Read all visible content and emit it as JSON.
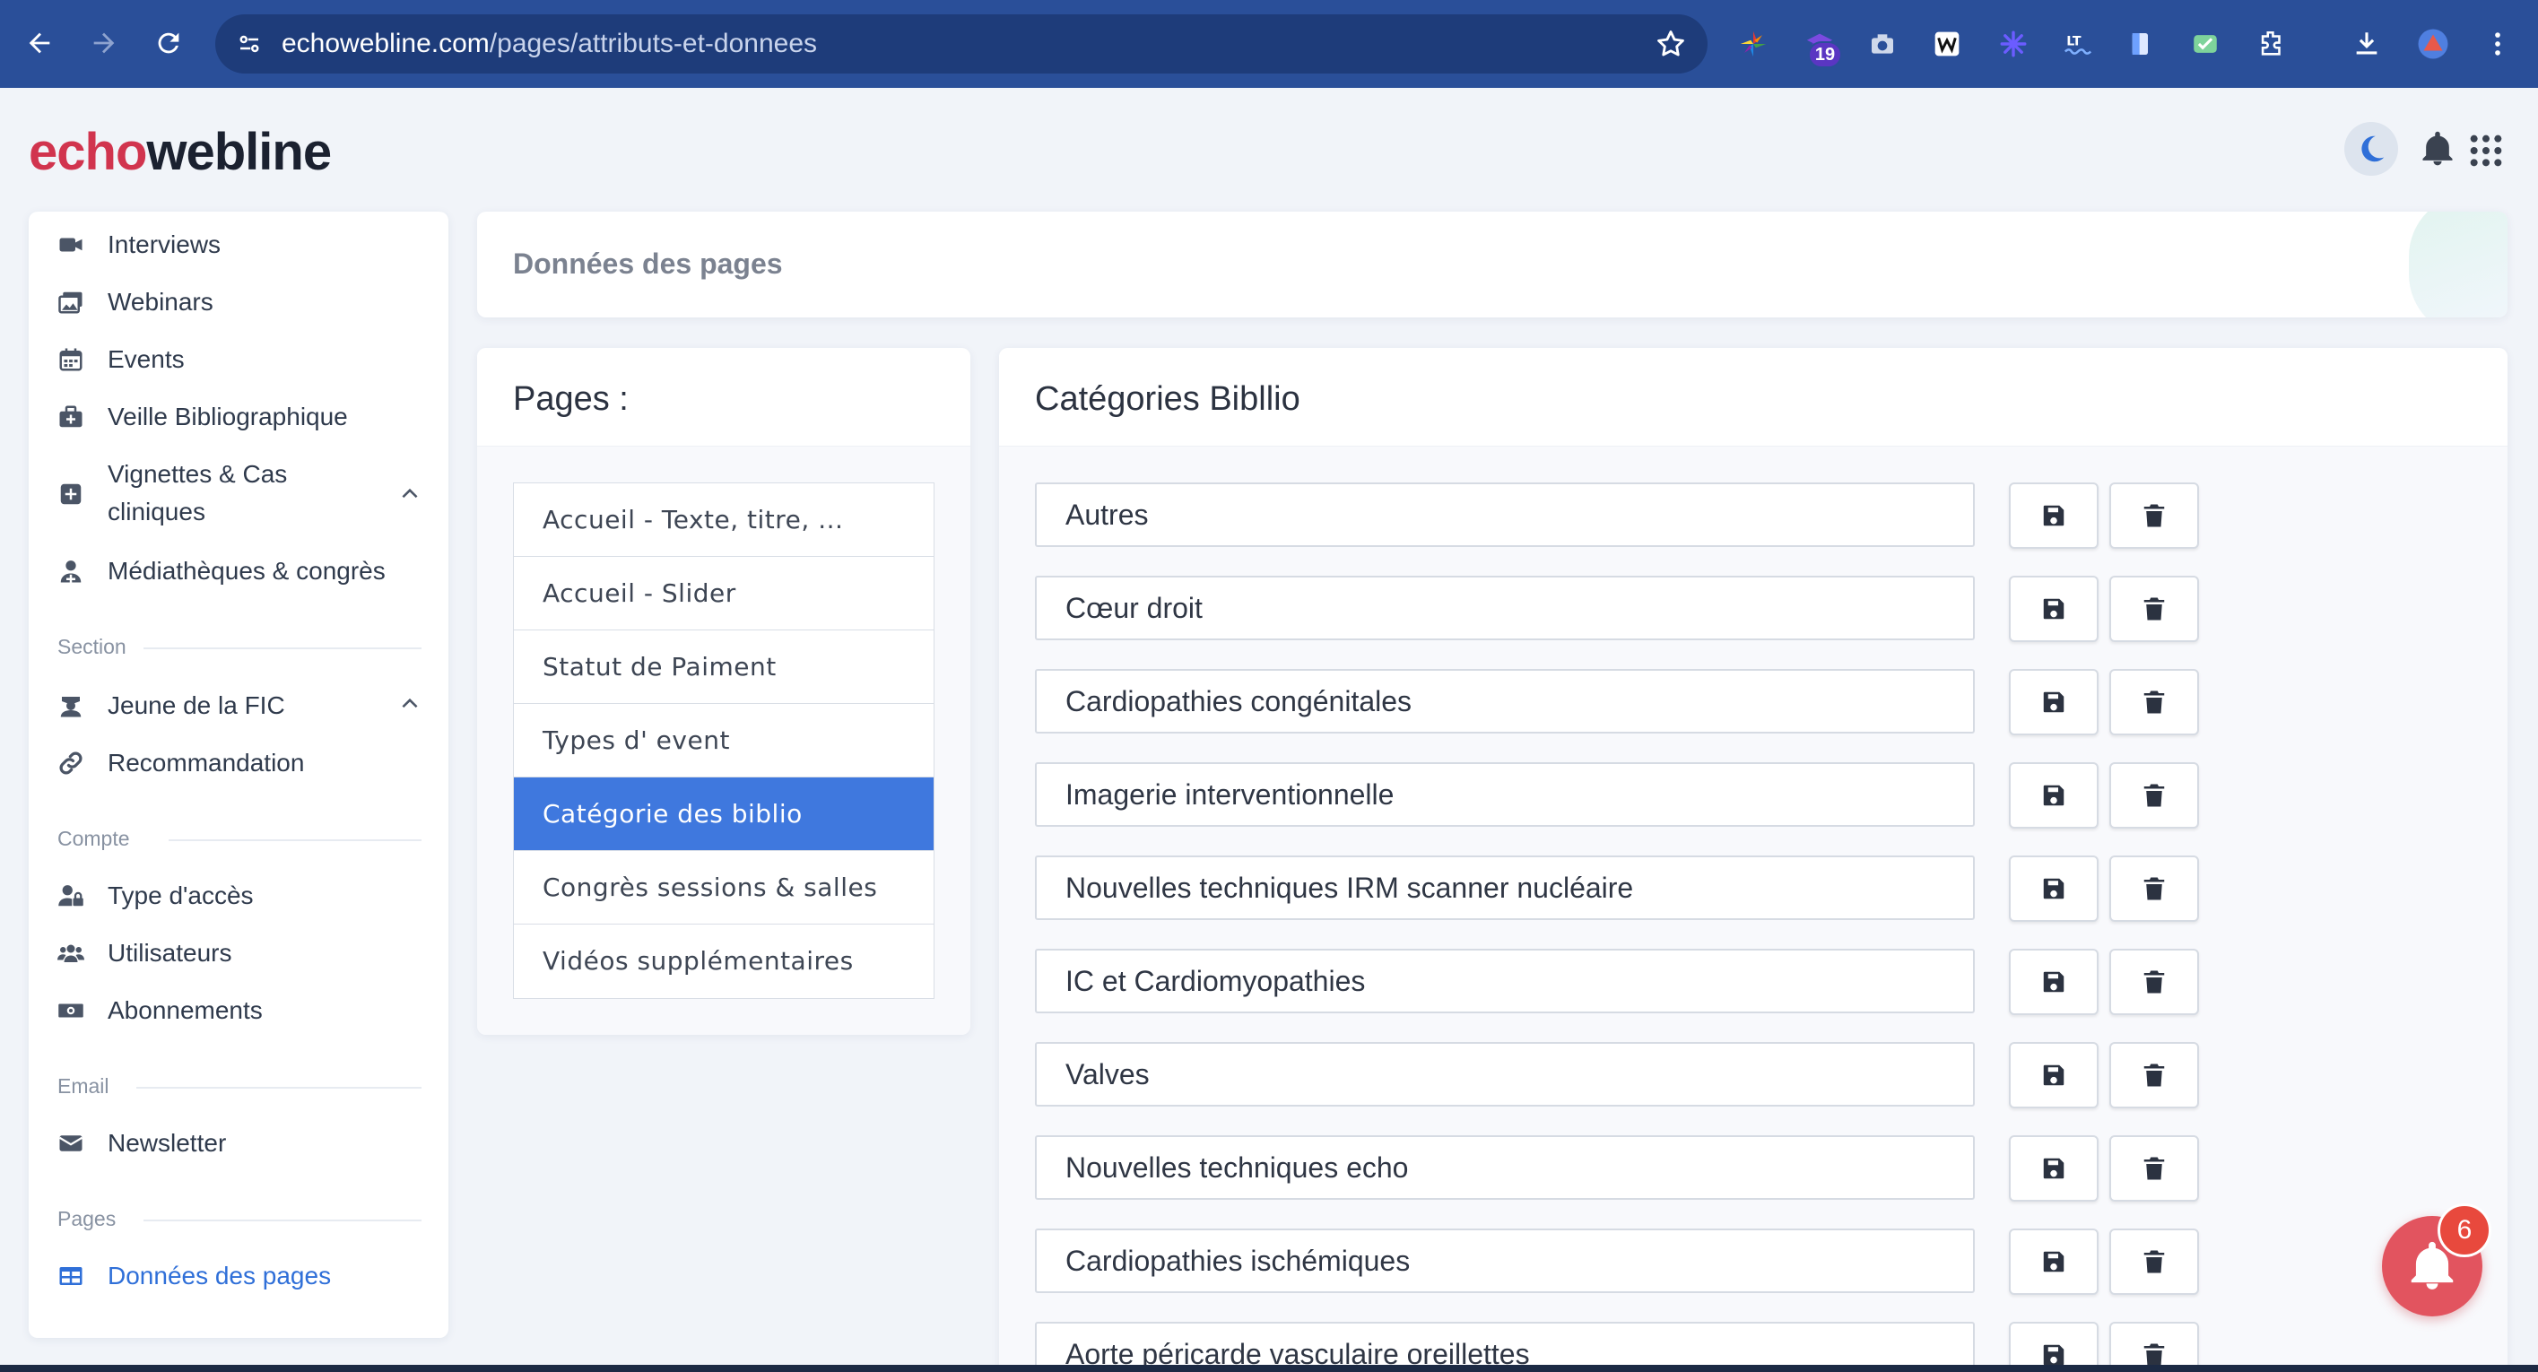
{
  "browser": {
    "url_domain": "echowebline.com",
    "url_path": "/pages/attributs-et-donnees",
    "extension_badge": "19"
  },
  "app": {
    "logo_part1": "echo",
    "logo_part2": "webline"
  },
  "sidebar": {
    "items": [
      {
        "label": "Interviews",
        "icon": "video-icon"
      },
      {
        "label": "Webinars",
        "icon": "photo-icon"
      },
      {
        "label": "Events",
        "icon": "calendar-icon"
      },
      {
        "label": "Veille Bibliographique",
        "icon": "briefcase-medical-icon"
      },
      {
        "label": "Vignettes & Cas cliniques",
        "icon": "plus-square-icon"
      },
      {
        "label": "Médiathèques & congrès",
        "icon": "user-doctor-icon"
      }
    ],
    "section_section": "Section",
    "section_items": [
      {
        "label": "Jeune de la FIC",
        "icon": "graduate-icon"
      },
      {
        "label": "Recommandation",
        "icon": "link-icon"
      }
    ],
    "section_compte": "Compte",
    "compte_items": [
      {
        "label": "Type d'accès",
        "icon": "user-lock-icon"
      },
      {
        "label": "Utilisateurs",
        "icon": "users-icon"
      },
      {
        "label": "Abonnements",
        "icon": "money-icon"
      }
    ],
    "section_email": "Email",
    "email_items": [
      {
        "label": "Newsletter",
        "icon": "envelope-icon"
      }
    ],
    "section_pages": "Pages",
    "pages_items": [
      {
        "label": "Données des pages",
        "icon": "table-icon"
      }
    ]
  },
  "header": {
    "title": "Données des pages"
  },
  "pages_panel": {
    "title": "Pages :",
    "items": [
      "Accueil - Texte, titre, ...",
      "Accueil - Slider",
      "Statut de Paiment",
      "Types d' event",
      "Catégorie des biblio",
      "Congrès sessions & salles",
      "Vidéos supplémentaires"
    ],
    "active_index": 4
  },
  "categories_panel": {
    "title": "Catégories Bibllio",
    "items": [
      "Autres",
      "Cœur droit",
      "Cardiopathies congénitales",
      "Imagerie interventionnelle",
      "Nouvelles techniques IRM scanner nucléaire",
      "IC et Cardiomyopathies",
      "Valves",
      "Nouvelles techniques echo",
      "Cardiopathies ischémiques",
      "Aorte péricarde vasculaire oreillettes"
    ]
  },
  "notifications": {
    "count": "6"
  },
  "colors": {
    "brand_red": "#d1344e",
    "accent_blue": "#3f78de",
    "browser_bar": "#2a4f99"
  }
}
